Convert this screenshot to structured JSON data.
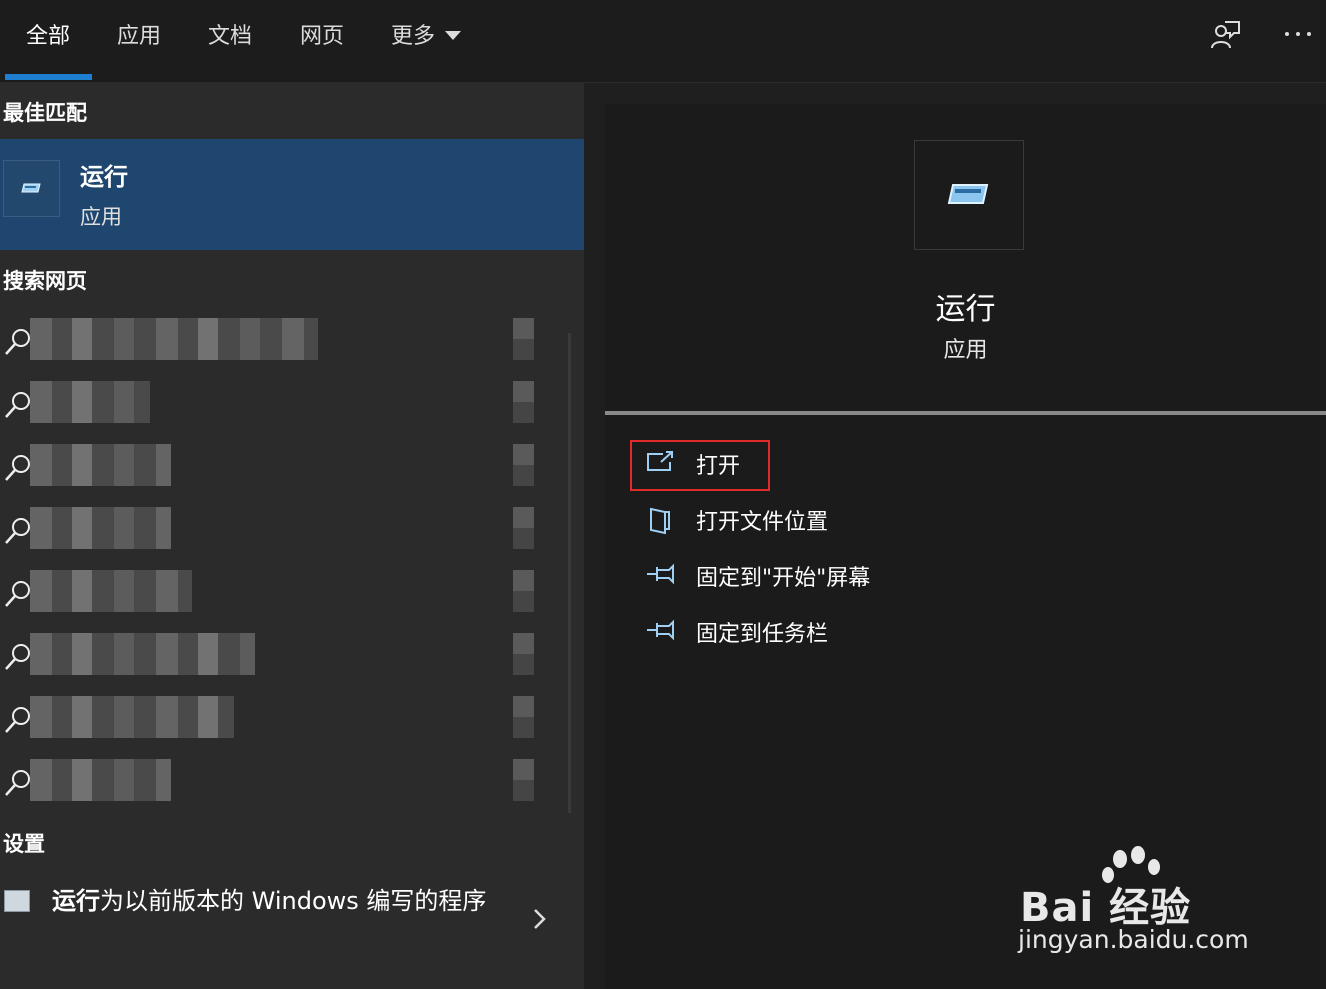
{
  "tabs": [
    {
      "label": "全部",
      "active": true
    },
    {
      "label": "应用"
    },
    {
      "label": "文档"
    },
    {
      "label": "网页"
    },
    {
      "label": "更多"
    }
  ],
  "top_icons": [
    "feedback-icon",
    "more-options-icon"
  ],
  "best_match": {
    "section_title": "最佳匹配",
    "title": "运行",
    "subtitle": "应用"
  },
  "web_search": {
    "section_title": "搜索网页",
    "row_count_visible": 8
  },
  "settings": {
    "section_title": "设置",
    "item_bold": "运行",
    "item_rest": "为以前版本的 Windows 编写的程序"
  },
  "detail": {
    "title": "运行",
    "subtitle": "应用",
    "actions": [
      {
        "label": "打开",
        "icon": "open-icon"
      },
      {
        "label": "打开文件位置",
        "icon": "file-location-icon"
      },
      {
        "label": "固定到\"开始\"屏幕",
        "icon": "pin-icon"
      },
      {
        "label": "固定到任务栏",
        "icon": "pin-icon"
      }
    ]
  },
  "watermark": {
    "text": "Bai 经验",
    "url": "jingyan.baidu.com"
  },
  "colors": {
    "accent": "#1e7fd0",
    "selected_bg": "#1e466e",
    "highlight_border": "#e02b2b"
  }
}
